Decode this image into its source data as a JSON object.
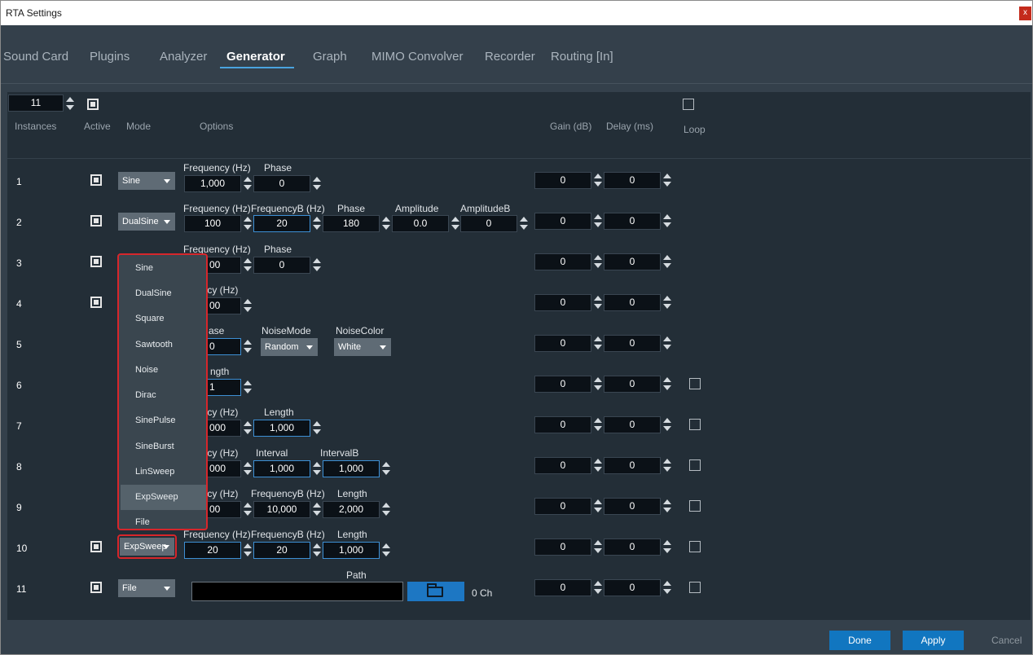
{
  "window": {
    "title": "RTA Settings",
    "close_glyph": "x"
  },
  "tabs": [
    {
      "label": "Sound Card",
      "active": false
    },
    {
      "label": "Plugins",
      "active": false
    },
    {
      "label": "Analyzer",
      "active": false
    },
    {
      "label": "Generator",
      "active": true
    },
    {
      "label": "Graph",
      "active": false
    },
    {
      "label": "MIMO Convolver",
      "active": false
    },
    {
      "label": "Recorder",
      "active": false
    },
    {
      "label": "Routing [In]",
      "active": false
    }
  ],
  "top": {
    "instances_value": "11",
    "active_all_checked": true,
    "loop_all_checked": false
  },
  "headers": {
    "instances": "Instances",
    "active": "Active",
    "mode": "Mode",
    "options": "Options",
    "gain": "Gain (dB)",
    "delay": "Delay (ms)",
    "loop": "Loop"
  },
  "rows": [
    {
      "num": "1",
      "mode": "Sine",
      "gain": "0",
      "delay": "0"
    },
    {
      "num": "2",
      "mode": "DualSine",
      "gain": "0",
      "delay": "0"
    },
    {
      "num": "3",
      "mode": "",
      "gain": "0",
      "delay": "0"
    },
    {
      "num": "4",
      "mode": "",
      "gain": "0",
      "delay": "0"
    },
    {
      "num": "5",
      "mode": "",
      "gain": "0",
      "delay": "0"
    },
    {
      "num": "6",
      "mode": "",
      "gain": "0",
      "delay": "0"
    },
    {
      "num": "7",
      "mode": "",
      "gain": "0",
      "delay": "0"
    },
    {
      "num": "8",
      "mode": "",
      "gain": "0",
      "delay": "0"
    },
    {
      "num": "9",
      "mode": "",
      "gain": "0",
      "delay": "0"
    },
    {
      "num": "10",
      "mode": "ExpSweep",
      "gain": "0",
      "delay": "0"
    },
    {
      "num": "11",
      "mode": "File",
      "gain": "0",
      "delay": "0"
    }
  ],
  "options": {
    "r1": {
      "l1": "Frequency (Hz)",
      "v1": "1,000",
      "l2": "Phase",
      "v2": "0"
    },
    "r2": {
      "l1": "Frequency (Hz)",
      "v1": "100",
      "l2": "FrequencyB (Hz)",
      "v2": "20",
      "l3": "Phase",
      "v3": "180",
      "l4": "Amplitude",
      "v4": "0.0",
      "l5": "AmplitudeB",
      "v5": "0"
    },
    "r3": {
      "l1": "Frequency (Hz)",
      "v1": "00",
      "l2": "Phase",
      "v2": "0"
    },
    "r4": {
      "l1": "ency (Hz)",
      "v1": "00"
    },
    "r5": {
      "l1": "ase",
      "v1": "0",
      "l2": "NoiseMode",
      "v2": "Random",
      "l3": "NoiseColor",
      "v3": "White"
    },
    "r6": {
      "l1": "ngth",
      "v1": "1"
    },
    "r7": {
      "l1": "ency (Hz)",
      "v1": "000",
      "l2": "Length",
      "v2": "1,000"
    },
    "r8": {
      "l1": "ency (Hz)",
      "v1": "000",
      "l2": "Interval",
      "v2": "1,000",
      "l3": "IntervalB",
      "v3": "1,000"
    },
    "r9": {
      "l1": "ency (Hz)",
      "v1": "00",
      "l2": "FrequencyB (Hz)",
      "v2": "10,000",
      "l3": "Length",
      "v3": "2,000"
    },
    "r10": {
      "l1": "Frequency (Hz)",
      "v1": "20",
      "l2": "FrequencyB (Hz)",
      "v2": "20",
      "l3": "Length",
      "v3": "1,000"
    },
    "r11": {
      "path_label": "Path",
      "channels": "0 Ch"
    }
  },
  "menu": {
    "items": [
      "Sine",
      "DualSine",
      "Square",
      "Sawtooth",
      "Noise",
      "Dirac",
      "SinePulse",
      "SineBurst",
      "LinSweep",
      "ExpSweep",
      "File"
    ],
    "highlighted": "ExpSweep"
  },
  "footer": {
    "done": "Done",
    "apply": "Apply",
    "cancel": "Cancel"
  },
  "colors": {
    "accent": "#1176c0",
    "highlight_outline": "#d7262b",
    "background": "#232e37"
  }
}
